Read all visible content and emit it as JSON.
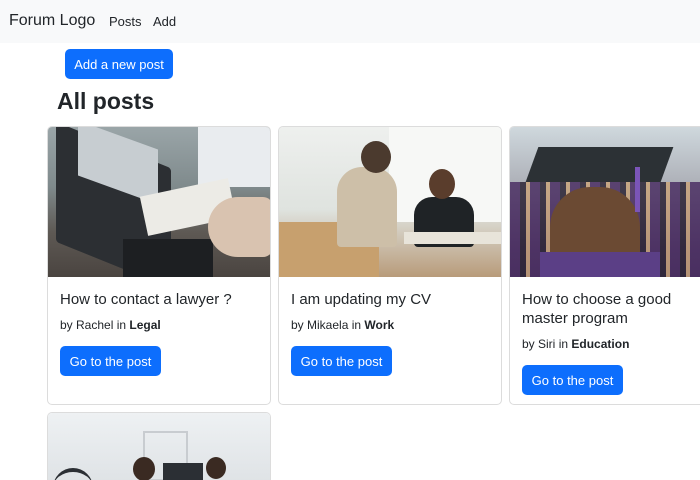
{
  "navbar": {
    "brand": "Forum Logo",
    "links": [
      "Posts",
      "Add"
    ]
  },
  "actions": {
    "add_post_label": "Add a new post"
  },
  "page": {
    "title": "All posts"
  },
  "posts": [
    {
      "title": "How to contact a lawyer ?",
      "author": "Rachel",
      "in_word": "in",
      "category": "Legal",
      "button": "Go to the post",
      "image": "lawyer-desk-laptop"
    },
    {
      "title": "I am updating my CV",
      "author": "Mikaela",
      "in_word": "in",
      "category": "Work",
      "button": "Go to the post",
      "image": "two-people-meeting"
    },
    {
      "title": "How to choose a good master program",
      "author": "Siri",
      "in_word": "in",
      "category": "Education",
      "button": "Go to the post",
      "image": "graduation-cap"
    },
    {
      "image": "office-people-monitor"
    }
  ],
  "colors": {
    "primary": "#0d6efd",
    "navbar_bg": "#f8f9fa",
    "card_border": "#dcdcdc"
  }
}
